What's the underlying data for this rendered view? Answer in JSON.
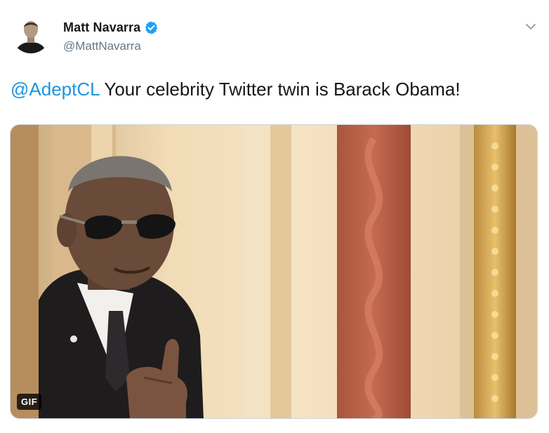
{
  "author": {
    "display_name": "Matt Navarra",
    "handle": "@MattNavarra",
    "verified": true
  },
  "tweet": {
    "mention": "@AdeptCL",
    "text": " Your celebrity Twitter twin is Barack Obama!"
  },
  "media": {
    "type": "gif",
    "badge_label": "GIF"
  },
  "icons": {
    "verified": "verified-badge-icon",
    "more": "chevron-down-icon"
  },
  "colors": {
    "link": "#1b95e0",
    "verified": "#1da1f2",
    "secondary_text": "#657786",
    "primary_text": "#14171a"
  }
}
